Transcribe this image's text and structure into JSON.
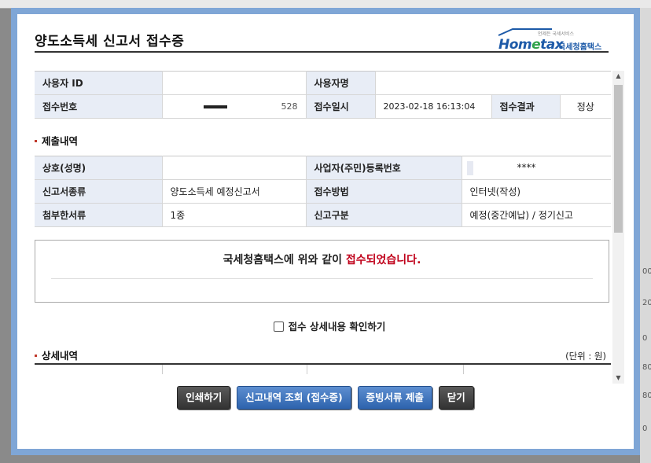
{
  "background": {
    "right_numbers": [
      "00",
      "20",
      "0",
      "80",
      "80",
      "0"
    ]
  },
  "dialog": {
    "title": "양도소득세 신고서 접수증",
    "logo": {
      "small": "언제든 국세서비스",
      "word_pre": "Hom",
      "word_e": "e",
      "word_post": "tax",
      "kr": "국세청홈택스"
    }
  },
  "receipt": {
    "user_id_label": "사용자 ID",
    "user_id_value": "",
    "user_name_label": "사용자명",
    "user_name_value": "",
    "receipt_no_label": "접수번호",
    "receipt_no_tail": "528",
    "receipt_date_label": "접수일시",
    "receipt_date_value": "2023-02-18 16:13:04",
    "receipt_result_label": "접수결과",
    "receipt_result_value": "정상"
  },
  "submission": {
    "section_title": "제출내역",
    "name_label": "상호(성명)",
    "name_value": "",
    "reg_no_label": "사업자(주민)등록번호",
    "reg_no_value": "****",
    "form_type_label": "신고서종류",
    "form_type_value": "양도소득세 예정신고서",
    "method_label": "접수방법",
    "method_value": "인터넷(작성)",
    "attach_label": "첨부한서류",
    "attach_value": "1종",
    "category_label": "신고구분",
    "category_value": "예정(중간예납) / 정기신고"
  },
  "notice": {
    "message_pre": "국세청홈택스에 위와 같이 ",
    "message_red": "접수되었습니다."
  },
  "check": {
    "label": "접수 상세내용 확인하기"
  },
  "detail": {
    "section_title": "상세내역",
    "unit": "(단위 : 원)"
  },
  "buttons": {
    "print": "인쇄하기",
    "history": "신고내역 조회 (접수증)",
    "evidence": "증빙서류 제출",
    "close": "닫기"
  },
  "colors": {
    "dialog_border": "#7fa6d6",
    "header_cell": "#e8edf6",
    "accent_red": "#c0001a",
    "button_blue": "#2d63ad",
    "button_dark": "#333333"
  }
}
